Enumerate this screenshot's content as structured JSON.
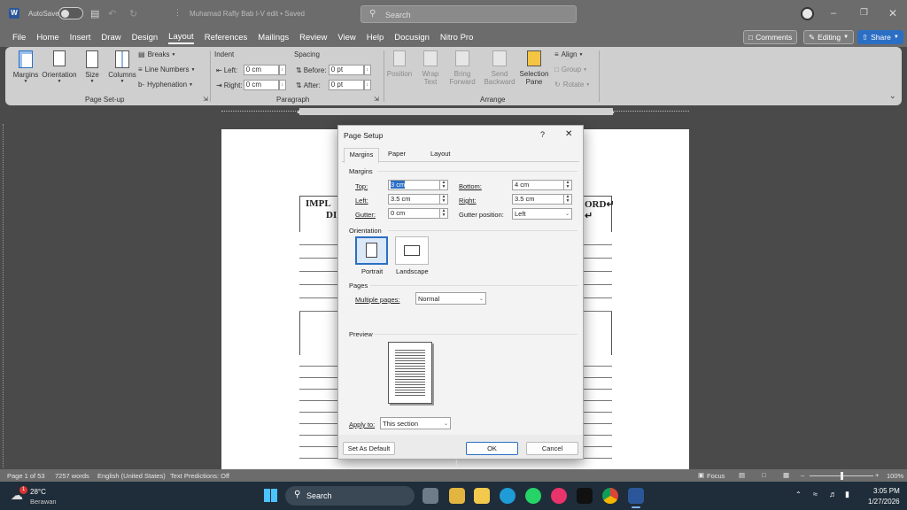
{
  "titlebar": {
    "autosave": "AutoSave",
    "doc_title": "Muhamad Rafly Bab I-V edit • Saved",
    "search_placeholder": "Search"
  },
  "menu": [
    "File",
    "Home",
    "Insert",
    "Draw",
    "Design",
    "Layout",
    "References",
    "Mailings",
    "Review",
    "View",
    "Help",
    "Docusign",
    "Nitro Pro"
  ],
  "menu_right": {
    "comments": "Comments",
    "editing": "Editing",
    "share": "Share"
  },
  "ribbon": {
    "page_setup": {
      "margins": "Margins",
      "orientation": "Orientation",
      "size": "Size",
      "columns": "Columns",
      "breaks": "Breaks",
      "line_numbers": "Line Numbers",
      "hyphenation": "Hyphenation",
      "group_label": "Page Set-up"
    },
    "paragraph": {
      "indent": "Indent",
      "spacing": "Spacing",
      "left_label": "Left:",
      "left_value": "0 cm",
      "right_label": "Right:",
      "right_value": "0 cm",
      "before_label": "Before:",
      "before_value": "0 pt",
      "after_label": "After:",
      "after_value": "0 pt",
      "group_label": "Paragraph"
    },
    "arrange": {
      "position": "Position",
      "wrap_text": "Wrap Text",
      "bring_forward": "Bring Forward",
      "send_backward": "Send Backward",
      "selection_pane": "Selection Pane",
      "align": "Align",
      "group": "Group",
      "rotate": "Rotate",
      "group_label": "Arrange"
    }
  },
  "document": {
    "line1_left": "IMPL",
    "line1_right": "ORD↵",
    "line2_left": "DI",
    "line2_right": "↵"
  },
  "dialog": {
    "title": "Page Setup",
    "help": "?",
    "tabs": [
      "Margins",
      "Paper",
      "Layout"
    ],
    "margins_label": "Margins",
    "top_label": "Top:",
    "top_value": "3 cm",
    "bottom_label": "Bottom:",
    "bottom_value": "4 cm",
    "left_label": "Left:",
    "left_value": "3.5 cm",
    "right_label": "Right:",
    "right_value": "3.5 cm",
    "gutter_label": "Gutter:",
    "gutter_value": "0 cm",
    "gutter_pos_label": "Gutter position:",
    "gutter_pos_value": "Left",
    "orientation_label": "Orientation",
    "portrait": "Portrait",
    "landscape": "Landscape",
    "pages_label": "Pages",
    "multiple_pages_label": "Multiple pages:",
    "multiple_pages_value": "Normal",
    "preview_label": "Preview",
    "apply_to_label": "Apply to:",
    "apply_to_value": "This section",
    "set_default": "Set As Default",
    "ok": "OK",
    "cancel": "Cancel"
  },
  "status": {
    "page": "Page 1 of 53",
    "words": "7257 words",
    "language": "English (United States)",
    "predictions": "Text Predictions: Off",
    "focus": "Focus",
    "zoom": "100%"
  },
  "taskbar": {
    "weather_temp": "28°C",
    "weather_desc": "Berawan",
    "weather_badge": "1",
    "search": "Search",
    "time": "3:05 PM",
    "date": "1/27/2026"
  },
  "colors": {
    "accent": "#2b6fc4",
    "word_blue": "#2b579a"
  }
}
